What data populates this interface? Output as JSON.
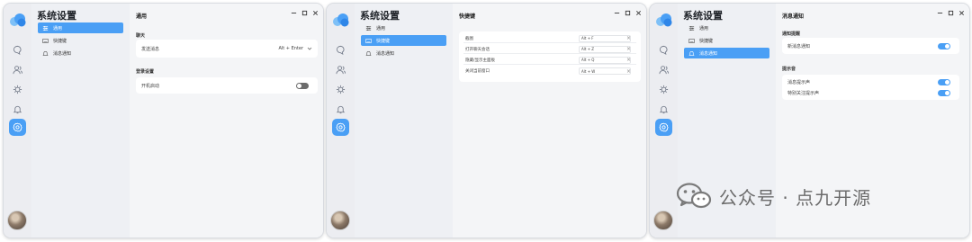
{
  "sidebar": {
    "title": "系统设置",
    "items": [
      {
        "label": "通用",
        "icon": "sliders-icon"
      },
      {
        "label": "快捷键",
        "icon": "keyboard-icon"
      },
      {
        "label": "消息通知",
        "icon": "bell-icon"
      }
    ]
  },
  "rail_icons": [
    "chat-icon",
    "contacts-icon",
    "plugin-icon",
    "bell-icon",
    "settings-icon"
  ],
  "window_controls": [
    "minimize-icon",
    "maximize-icon",
    "close-icon"
  ],
  "window1": {
    "title": "通用",
    "chat_section": "聊天",
    "send_message_label": "发送消息",
    "send_message_value": "Alt + Enter",
    "login_section": "登录设置",
    "autostart_label": "开机启动",
    "autostart_on": false
  },
  "window2": {
    "title": "快捷键",
    "shortcuts": [
      {
        "label": "截图",
        "key": "Alt + F"
      },
      {
        "label": "打开聊天会话",
        "key": "Alt + Z"
      },
      {
        "label": "隐藏/显示主面板",
        "key": "Alt + Q"
      },
      {
        "label": "关闭当前窗口",
        "key": "Alt + W"
      }
    ]
  },
  "window3": {
    "title": "消息通知",
    "notify_section": "通知提醒",
    "new_message_label": "新消息通知",
    "new_message_on": true,
    "sound_section": "提示音",
    "message_sound_label": "消息提示声",
    "message_sound_on": true,
    "special_sound_label": "特别关注提示声",
    "special_sound_on": true
  },
  "watermark": {
    "text": "公众号 · 点九开源"
  },
  "colors": {
    "accent": "#4a9ff5",
    "toggle_off": "#6c6c6c",
    "rail_bg": "#ecedf1",
    "nav_bg": "#eef0f4"
  }
}
